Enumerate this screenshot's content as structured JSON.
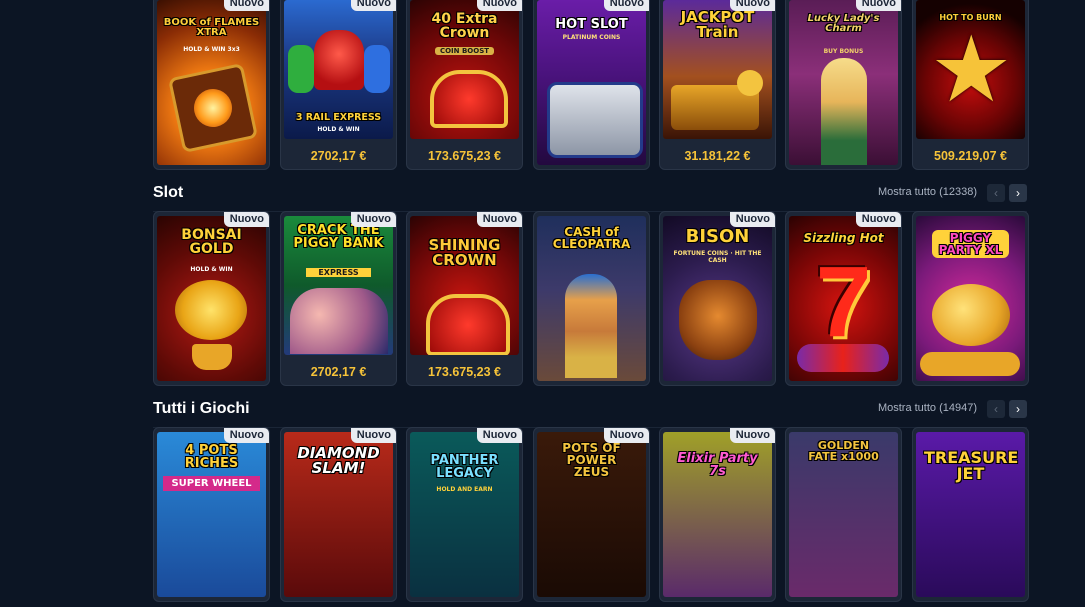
{
  "badge_new": "Nuovo",
  "top_row": [
    {
      "art": "BOOK of FLAMES XTRA",
      "art_sub": "HOLD & WIN 3x3",
      "new": true,
      "jackpot": ""
    },
    {
      "art": "3 RAIL EXPRESS",
      "art_sub": "HOLD & WIN",
      "new": true,
      "jackpot": "2702,17 €"
    },
    {
      "art": "40 Extra Crown",
      "art_sub": "COIN BOOST",
      "new": true,
      "jackpot": "173.675,23 €"
    },
    {
      "art": "HOT SLOT",
      "art_sub": "PLATINUM COINS",
      "new": true,
      "jackpot": ""
    },
    {
      "art": "JACKPOT Train",
      "art_sub": "",
      "new": true,
      "jackpot": "31.181,22 €"
    },
    {
      "art": "Lucky Lady's Charm",
      "art_sub": "BUY BONUS",
      "new": true,
      "jackpot": ""
    },
    {
      "art": "HOT TO BURN",
      "art_sub": "",
      "new": false,
      "jackpot": "509.219,07 €"
    }
  ],
  "slot_section": {
    "title": "Slot",
    "show_all": "Mostra tutto (12338)",
    "games": [
      {
        "art": "BONSAI GOLD",
        "art_sub": "HOLD & WIN",
        "new": true,
        "jackpot": ""
      },
      {
        "art": "CRACK THE PIGGY BANK",
        "art_sub": "EXPRESS",
        "new": true,
        "jackpot": "2702,17 €"
      },
      {
        "art": "SHINING CROWN",
        "art_sub": "",
        "new": true,
        "jackpot": "173.675,23 €"
      },
      {
        "art": "CASH of CLEOPATRA",
        "art_sub": "",
        "new": false,
        "jackpot": ""
      },
      {
        "art": "BISON",
        "art_sub": "FORTUNE COINS · HIT THE CASH",
        "new": true,
        "jackpot": ""
      },
      {
        "art": "Sizzling Hot",
        "art_sub": "",
        "new": true,
        "jackpot": ""
      },
      {
        "art": "PIGGY PARTY XL",
        "art_sub": "",
        "new": false,
        "jackpot": ""
      }
    ]
  },
  "all_games_section": {
    "title": "Tutti i Giochi",
    "show_all": "Mostra tutto (14947)",
    "games": [
      {
        "art": "4 POTS RICHES",
        "art_sub": "SUPER WHEEL",
        "new": true
      },
      {
        "art": "DIAMOND SLAM!",
        "art_sub": "",
        "new": true
      },
      {
        "art": "PANTHER LEGACY",
        "art_sub": "HOLD AND EARN",
        "new": true
      },
      {
        "art": "POTS OF POWER ZEUS",
        "art_sub": "",
        "new": true
      },
      {
        "art": "Elixir Party 7s",
        "art_sub": "",
        "new": true
      },
      {
        "art": "GOLDEN FATE x1000",
        "art_sub": "",
        "new": false
      },
      {
        "art": "TREASURE JET",
        "art_sub": "",
        "new": false
      }
    ]
  },
  "nav": {
    "prev_icon": "‹",
    "next_icon": "›"
  },
  "colors": {
    "background": "#0c1524",
    "card": "#1c2637",
    "jackpot": "#f6c339",
    "badge": "#e9ecf1"
  }
}
